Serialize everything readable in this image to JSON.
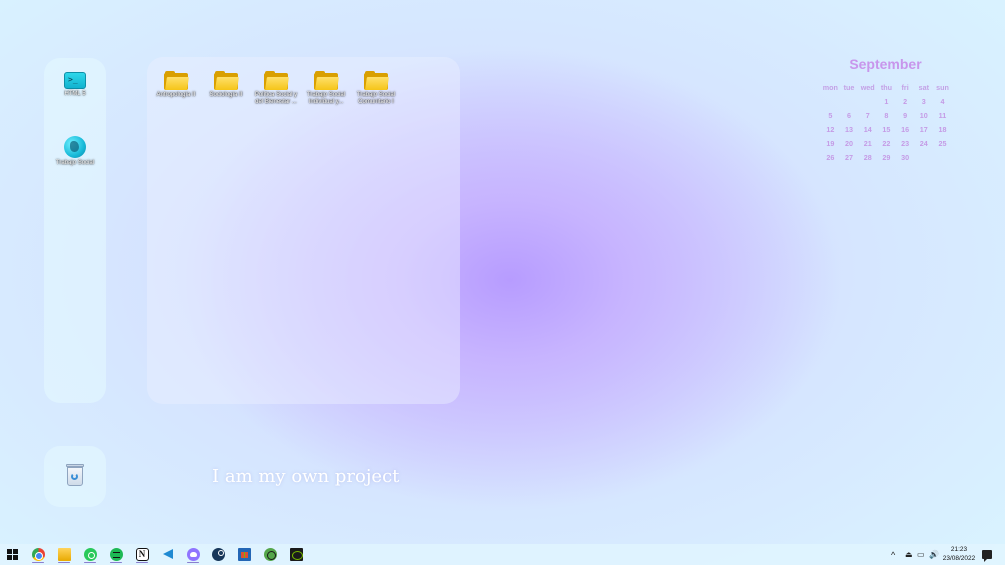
{
  "desktop": {
    "left_icons": [
      {
        "label": "HTML 5",
        "icon": "terminal-icon"
      },
      {
        "label": "Trabajo Social",
        "icon": "globe-icon"
      }
    ],
    "folders": [
      {
        "label": "Antropología II",
        "icon": "folder-icon"
      },
      {
        "label": "Sociología II",
        "icon": "folder-icon"
      },
      {
        "label": "Política Social y del Bienestar ...",
        "icon": "folder-icon"
      },
      {
        "label": "Trabajo Social Individual y...",
        "icon": "folder-icon"
      },
      {
        "label": "Trabajo Social Comunitario I",
        "icon": "folder-icon"
      }
    ],
    "recycle_bin": {
      "icon": "recycle-bin-icon"
    },
    "quote": "I am my own project"
  },
  "calendar": {
    "month": "September",
    "weekdays": [
      "mon",
      "tue",
      "wed",
      "thu",
      "fri",
      "sat",
      "sun"
    ],
    "weeks": [
      [
        "",
        "",
        "",
        "1",
        "2",
        "3",
        "4"
      ],
      [
        "5",
        "6",
        "7",
        "8",
        "9",
        "10",
        "11"
      ],
      [
        "12",
        "13",
        "14",
        "15",
        "16",
        "17",
        "18"
      ],
      [
        "19",
        "20",
        "21",
        "22",
        "23",
        "24",
        "25"
      ],
      [
        "26",
        "27",
        "28",
        "29",
        "30",
        "",
        ""
      ]
    ],
    "color": "#c896ec"
  },
  "taskbar": {
    "apps": [
      {
        "name": "start",
        "icon": "windows-start-icon",
        "active": false
      },
      {
        "name": "Google Chrome",
        "icon": "chrome-icon",
        "active": true
      },
      {
        "name": "File Explorer",
        "icon": "file-explorer-icon",
        "active": true
      },
      {
        "name": "WhatsApp",
        "icon": "whatsapp-icon",
        "active": true
      },
      {
        "name": "Spotify",
        "icon": "spotify-icon",
        "active": true
      },
      {
        "name": "Notion",
        "icon": "notion-icon",
        "active": true
      },
      {
        "name": "Visual Studio Code",
        "icon": "vscode-icon",
        "active": false
      },
      {
        "name": "Discord",
        "icon": "discord-icon",
        "active": true
      },
      {
        "name": "Steam",
        "icon": "steam-icon",
        "active": false
      },
      {
        "name": "Microsoft Store",
        "icon": "store-icon",
        "active": false
      },
      {
        "name": "Xbox",
        "icon": "xbox-icon",
        "active": false
      },
      {
        "name": "NVIDIA",
        "icon": "nvidia-icon",
        "active": false
      }
    ],
    "notion_glyph": "N",
    "tray": {
      "chevron": "^",
      "usb": "⏏",
      "network": "▭",
      "volume": "🔊"
    },
    "clock": {
      "time": "21:23",
      "date": "23/08/2022"
    }
  }
}
